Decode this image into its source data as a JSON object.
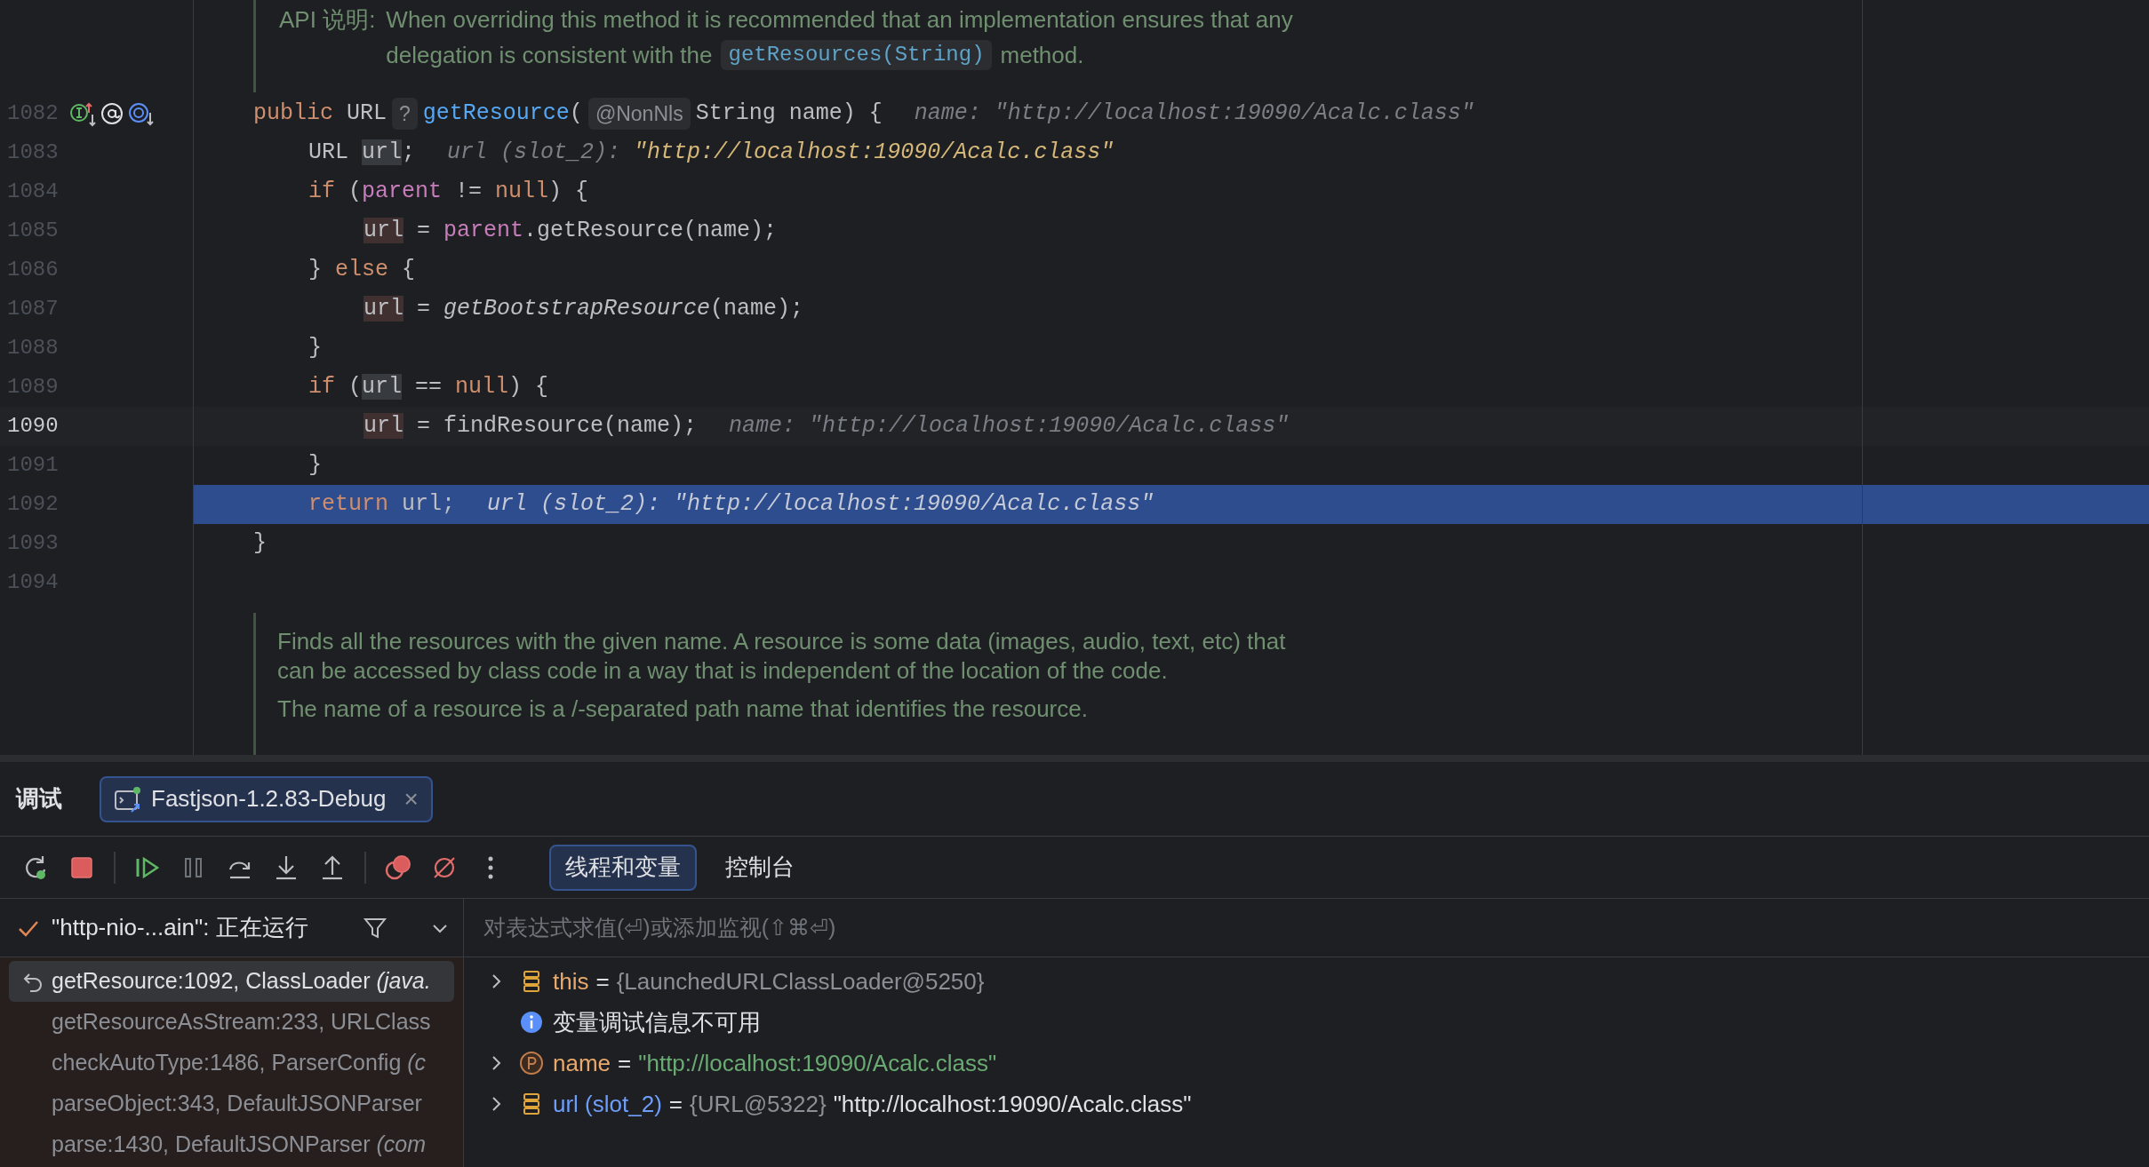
{
  "editor": {
    "doc_top": {
      "label": "API 说明:",
      "lines": [
        [
          {
            "kind": "text",
            "text": "When overriding this method it is recommended that an implementation ensures that any"
          }
        ],
        [
          {
            "kind": "text",
            "text": "delegation is consistent with the"
          },
          {
            "kind": "code",
            "text": "getResources(String)"
          },
          {
            "kind": "text",
            "text": "method."
          }
        ]
      ]
    },
    "lines": [
      {
        "number": "1082",
        "gutter_icons": true,
        "current_line": false,
        "execution_point": false,
        "segments": [
          {
            "kind": "keyword",
            "text": "public"
          },
          {
            "kind": "plain",
            "text": " URL"
          },
          {
            "kind": "badge",
            "text": "?"
          },
          {
            "kind": "method",
            "text": "getResource"
          },
          {
            "kind": "plain",
            "text": "("
          },
          {
            "kind": "badge",
            "text": "@NonNls"
          },
          {
            "kind": "plain",
            "text": "String name) {"
          },
          {
            "kind": "hint",
            "text": "name: \"http://localhost:19090/Acalc.class\""
          }
        ],
        "children": [
          {
            "number": "1083",
            "current_line": false,
            "execution_point": false,
            "segments": [
              {
                "kind": "plain",
                "text": "URL "
              },
              {
                "kind": "usage_read",
                "text": "url"
              },
              {
                "kind": "plain",
                "text": ";"
              },
              {
                "kind": "hint",
                "text": "url (slot_2): "
              },
              {
                "kind": "hint_value",
                "text": "\"http://localhost:19090/Acalc.class\""
              }
            ]
          },
          {
            "number": "1084",
            "current_line": false,
            "execution_point": false,
            "segments": [
              {
                "kind": "keyword",
                "text": "if"
              },
              {
                "kind": "plain",
                "text": " ("
              },
              {
                "kind": "field",
                "text": "parent"
              },
              {
                "kind": "plain",
                "text": " != "
              },
              {
                "kind": "keyword",
                "text": "null"
              },
              {
                "kind": "plain",
                "text": ") {"
              }
            ],
            "children": [
              {
                "number": "1085",
                "current_line": false,
                "execution_point": false,
                "segments": [
                  {
                    "kind": "usage_write",
                    "text": "url"
                  },
                  {
                    "kind": "plain",
                    "text": " = "
                  },
                  {
                    "kind": "field",
                    "text": "parent"
                  },
                  {
                    "kind": "plain",
                    "text": ".getResource(name);"
                  }
                ]
              }
            ]
          },
          {
            "number": "1086",
            "current_line": false,
            "execution_point": false,
            "segments": [
              {
                "kind": "plain",
                "text": "} "
              },
              {
                "kind": "keyword",
                "text": "else"
              },
              {
                "kind": "plain",
                "text": " {"
              }
            ],
            "children": [
              {
                "number": "1087",
                "current_line": false,
                "execution_point": false,
                "segments": [
                  {
                    "kind": "usage_write",
                    "text": "url"
                  },
                  {
                    "kind": "plain",
                    "text": " = "
                  },
                  {
                    "kind": "static_call",
                    "text": "getBootstrapResource"
                  },
                  {
                    "kind": "plain",
                    "text": "(name);"
                  }
                ]
              }
            ]
          },
          {
            "number": "1088",
            "current_line": false,
            "execution_point": false,
            "segments": [
              {
                "kind": "plain",
                "text": "}"
              }
            ]
          },
          {
            "number": "1089",
            "current_line": false,
            "execution_point": false,
            "segments": [
              {
                "kind": "keyword",
                "text": "if"
              },
              {
                "kind": "plain",
                "text": " ("
              },
              {
                "kind": "usage_read",
                "text": "url"
              },
              {
                "kind": "plain",
                "text": " == "
              },
              {
                "kind": "keyword",
                "text": "null"
              },
              {
                "kind": "plain",
                "text": ") {"
              }
            ],
            "children": [
              {
                "number": "1090",
                "current_line": true,
                "execution_point": false,
                "segments": [
                  {
                    "kind": "usage_write",
                    "text": "url"
                  },
                  {
                    "kind": "plain",
                    "text": " = findResource(name);"
                  },
                  {
                    "kind": "hint",
                    "text": "name: \"http://localhost:19090/Acalc.class\""
                  }
                ]
              }
            ]
          },
          {
            "number": "1091",
            "current_line": false,
            "execution_point": false,
            "segments": [
              {
                "kind": "plain",
                "text": "}"
              }
            ]
          },
          {
            "number": "1092",
            "current_line": false,
            "execution_point": true,
            "segments": [
              {
                "kind": "keyword",
                "text": "return"
              },
              {
                "kind": "plain",
                "text": " url;"
              },
              {
                "kind": "hint",
                "text": "url (slot_2): \"http://localhost:19090/Acalc.class\""
              }
            ]
          }
        ]
      },
      {
        "number": "1093",
        "current_line": false,
        "execution_point": false,
        "segments": [
          {
            "kind": "plain",
            "text": "}"
          }
        ]
      },
      {
        "number": "1094",
        "current_line": false,
        "execution_point": false
      }
    ],
    "doc_bottom": {
      "paragraphs": [
        "Finds all the resources with the given name. A resource is some data (images, audio, text, etc) that can be accessed by class code in a way that is independent of the location of the code.",
        "The name of a resource is a /-separated path name that identifies the resource."
      ]
    }
  },
  "debug_panel": {
    "title": "调试",
    "session_tabs": [
      {
        "label": "Fastjson-1.2.83-Debug",
        "selected": true,
        "close": "×"
      }
    ],
    "toolbar": [
      {
        "kind": "rerun"
      },
      {
        "kind": "stop"
      },
      {
        "kind": "resume"
      },
      {
        "kind": "pause"
      },
      {
        "kind": "step_over"
      },
      {
        "kind": "step_into"
      },
      {
        "kind": "step_out"
      },
      {
        "kind": "view_breakpoints"
      },
      {
        "kind": "mute_breakpoints"
      },
      {
        "kind": "more"
      }
    ],
    "view_tabs": [
      {
        "label": "线程和变量",
        "selected": true
      },
      {
        "label": "控制台",
        "selected": false
      }
    ],
    "thread": {
      "label": "\"http-nio-...ain\": 正在运行"
    },
    "frames": [
      {
        "method": "getResource:1092, ClassLoader",
        "package": "(java.",
        "selected": true
      },
      {
        "method": "getResourceAsStream:233, URLClass",
        "selected": false
      },
      {
        "method": "checkAutoType:1486, ParserConfig",
        "package": "(c",
        "selected": false
      },
      {
        "method": "parseObject:343, DefaultJSONParser",
        "selected": false
      },
      {
        "method": "parse:1430, DefaultJSONParser",
        "package": "(com",
        "selected": false
      }
    ],
    "evaluate": {
      "placeholder": "对表达式求值(⏎)或添加监视(⇧⌘⏎)"
    },
    "variables": [
      {
        "kind": "field",
        "name": "this",
        "eq": "=",
        "value": [
          {
            "kind": "ref",
            "text": "{LaunchedURLClassLoader@5250}"
          }
        ]
      },
      {
        "kind": "info",
        "text": "变量调试信息不可用"
      },
      {
        "kind": "parameter",
        "name": "name",
        "eq": "=",
        "value": [
          {
            "kind": "string",
            "text": "\"http://localhost:19090/Acalc.class\""
          }
        ]
      },
      {
        "kind": "local",
        "name": "url (slot_2)",
        "eq": "=",
        "value": [
          {
            "kind": "ref",
            "text": "{URL@5322}"
          },
          {
            "kind": "text",
            "text": "\"http://localhost:19090/Acalc.class\""
          }
        ]
      }
    ]
  }
}
